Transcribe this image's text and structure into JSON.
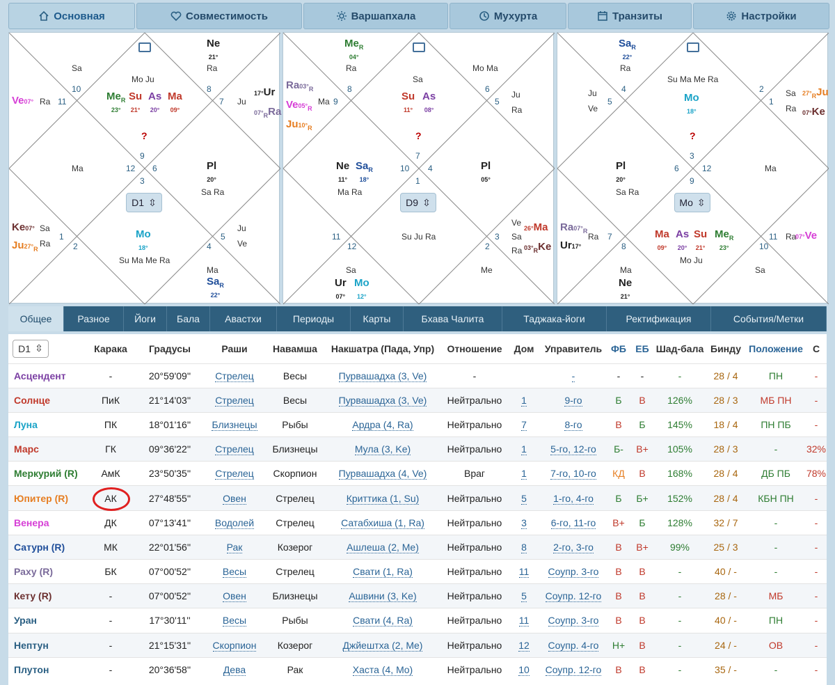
{
  "nav": [
    "Основная",
    "Совместимость",
    "Варшапхала",
    "Мухурта",
    "Транзиты",
    "Настройки"
  ],
  "colors": {
    "Su": "#c0392b",
    "Mo": "#1aa3c7",
    "Ma": "#c0392b",
    "Me": "#2e7d32",
    "Ju": "#e67e22",
    "Ve": "#d63fd6",
    "Sa": "#1f4e9a",
    "Ra": "#7a6a9a",
    "Ke": "#6b2f2f",
    "Ur": "#222",
    "Ne": "#222",
    "Pl": "#222",
    "As": "#7b3fa3"
  },
  "charts": [
    {
      "selector": "D1",
      "question": "?",
      "house_numbers": [
        "1",
        "2",
        "3",
        "4",
        "5",
        "6",
        "7",
        "8",
        "9",
        "10",
        "11",
        "12"
      ],
      "small": [
        "Sa",
        "Mo Ju",
        "Ra",
        "Ra",
        "Ju",
        "Ma",
        "Sa Ra",
        "Sa",
        "Ra",
        "Su Ma Me Ra",
        "Ju",
        "Ve",
        "Ma",
        "Ra"
      ],
      "planets": [
        {
          "p": "Ne",
          "deg": "21°",
          "r": ""
        },
        {
          "p": "Me",
          "deg": "23°",
          "r": "R"
        },
        {
          "p": "Su",
          "deg": "21°",
          "r": ""
        },
        {
          "p": "As",
          "deg": "20°",
          "r": ""
        },
        {
          "p": "Ma",
          "deg": "09°",
          "r": ""
        },
        {
          "p": "Ve",
          "deg": "07°",
          "r": ""
        },
        {
          "p": "Ur",
          "deg": "17°",
          "r": ""
        },
        {
          "p": "Ra",
          "deg": "07°",
          "r": "R"
        },
        {
          "p": "Pl",
          "deg": "20°",
          "r": ""
        },
        {
          "p": "Ke",
          "deg": "07°",
          "r": ""
        },
        {
          "p": "Ju",
          "deg": "27°",
          "r": "R"
        },
        {
          "p": "Mo",
          "deg": "18°",
          "r": ""
        },
        {
          "p": "Sa",
          "deg": "22°",
          "r": "R"
        }
      ]
    },
    {
      "selector": "D9",
      "question": "?",
      "small": [
        "Ra",
        "Sa",
        "Mo Ma",
        "Ma",
        "Ju",
        "Ra",
        "Ma Ra",
        "Sa",
        "Su Ju Ra",
        "Ve",
        "Ra",
        "Me",
        "Sa"
      ],
      "planets": [
        {
          "p": "Me",
          "deg": "04°",
          "r": "R"
        },
        {
          "p": "Ra",
          "deg": "03°",
          "r": "R"
        },
        {
          "p": "Ve",
          "deg": "05°",
          "r": "R"
        },
        {
          "p": "Ju",
          "deg": "10°",
          "r": "R"
        },
        {
          "p": "Su",
          "deg": "11°",
          "r": ""
        },
        {
          "p": "As",
          "deg": "08°",
          "r": ""
        },
        {
          "p": "Ne",
          "deg": "11°",
          "r": ""
        },
        {
          "p": "Sa",
          "deg": "18°",
          "r": "R"
        },
        {
          "p": "Pl",
          "deg": "05°",
          "r": ""
        },
        {
          "p": "Ma",
          "deg": "26°",
          "r": ""
        },
        {
          "p": "Ke",
          "deg": "03°",
          "r": "R"
        },
        {
          "p": "Ur",
          "deg": "07°",
          "r": ""
        },
        {
          "p": "Mo",
          "deg": "12°",
          "r": ""
        }
      ]
    },
    {
      "selector": "Mo",
      "question": "?",
      "small": [
        "Ma",
        "Su Ma Me Ra",
        "Sa",
        "Ra",
        "Ju",
        "Ve",
        "Sa Ra",
        "Ma",
        "Ra",
        "Mo Ju",
        "Ra",
        "Sa",
        "Ra"
      ],
      "planets": [
        {
          "p": "Sa",
          "deg": "22°",
          "r": "R"
        },
        {
          "p": "Mo",
          "deg": "18°",
          "r": ""
        },
        {
          "p": "Ju",
          "deg": "27°",
          "r": "R"
        },
        {
          "p": "Ke",
          "deg": "07°",
          "r": ""
        },
        {
          "p": "Pl",
          "deg": "20°",
          "r": ""
        },
        {
          "p": "Ra",
          "deg": "07°",
          "r": "R"
        },
        {
          "p": "Ur",
          "deg": "17°",
          "r": ""
        },
        {
          "p": "Ma",
          "deg": "09°",
          "r": ""
        },
        {
          "p": "As",
          "deg": "20°",
          "r": ""
        },
        {
          "p": "Su",
          "deg": "21°",
          "r": ""
        },
        {
          "p": "Me",
          "deg": "23°",
          "r": "R"
        },
        {
          "p": "Ve",
          "deg": "07°",
          "r": ""
        },
        {
          "p": "Ne",
          "deg": "21°",
          "r": ""
        }
      ]
    }
  ],
  "tabs": [
    "Общее",
    "Разное",
    "Йоги",
    "Бала",
    "Авастхи",
    "Периоды",
    "Карты",
    "Бхава Чалита",
    "Таджака-йоги",
    "Ректификация",
    "События/Метки"
  ],
  "table": {
    "selector": "D1",
    "headers": [
      "Карака",
      "Градусы",
      "Раши",
      "Навамша",
      "Накшатра (Пада, Упр)",
      "Отношение",
      "Дом",
      "Управитель",
      "ФБ",
      "ЕБ",
      "Шад-бала",
      "Бинду",
      "Положение",
      "С"
    ],
    "rows": [
      {
        "name": "Асцендент",
        "color": "#7b3fa3",
        "karaka": "-",
        "deg": "20°59'09''",
        "rashi": "Стрелец",
        "nav": "Весы",
        "nak": "Пурвашадха (3, Ve)",
        "rel": "-",
        "dom": "",
        "lord": "-",
        "fb": "-",
        "eb": "-",
        "shad": "-",
        "bindu": "28 / 4",
        "pos": "ПН",
        "s": "-"
      },
      {
        "name": "Солнце",
        "color": "#c0392b",
        "karaka": "ПиК",
        "deg": "21°14'03''",
        "rashi": "Стрелец",
        "nav": "Весы",
        "nak": "Пурвашадха (3, Ve)",
        "rel": "Нейтрально",
        "dom": "1",
        "lord": "9-го",
        "fb": "Б",
        "eb": "В",
        "shad": "126%",
        "bindu": "28 / 3",
        "pos": "МБ ПН",
        "s": "-"
      },
      {
        "name": "Луна",
        "color": "#1aa3c7",
        "karaka": "ПК",
        "deg": "18°01'16''",
        "rashi": "Близнецы",
        "nav": "Рыбы",
        "nak": "Ардра (4, Ra)",
        "rel": "Нейтрально",
        "dom": "7",
        "lord": "8-го",
        "fb": "В",
        "eb": "Б",
        "shad": "145%",
        "bindu": "18 / 4",
        "pos": "ПН ПБ",
        "s": "-"
      },
      {
        "name": "Марс",
        "color": "#c0392b",
        "karaka": "ГК",
        "deg": "09°36'22''",
        "rashi": "Стрелец",
        "nav": "Близнецы",
        "nak": "Мула (3, Ke)",
        "rel": "Нейтрально",
        "dom": "1",
        "lord": "5-го, 12-го",
        "fb": "Б-",
        "eb": "В+",
        "shad": "105%",
        "bindu": "28 / 3",
        "pos": "-",
        "s": "32%"
      },
      {
        "name": "Меркурий (R)",
        "color": "#2e7d32",
        "karaka": "АмК",
        "deg": "23°50'35''",
        "rashi": "Стрелец",
        "nav": "Скорпион",
        "nak": "Пурвашадха (4, Ve)",
        "rel": "Враг",
        "dom": "1",
        "lord": "7-го, 10-го",
        "fb": "КД",
        "eb": "В",
        "shad": "168%",
        "bindu": "28 / 4",
        "pos": "ДБ ПБ",
        "s": "78%"
      },
      {
        "name": "Юпитер (R)",
        "color": "#e67e22",
        "karaka": "АК",
        "deg": "27°48'55''",
        "rashi": "Овен",
        "nav": "Стрелец",
        "nak": "Криттика (1, Su)",
        "rel": "Нейтрально",
        "dom": "5",
        "lord": "1-го, 4-го",
        "fb": "Б",
        "eb": "Б+",
        "shad": "152%",
        "bindu": "28 / 4",
        "pos": "КБН ПН",
        "s": "-"
      },
      {
        "name": "Венера",
        "color": "#d63fd6",
        "karaka": "ДК",
        "deg": "07°13'41''",
        "rashi": "Водолей",
        "nav": "Стрелец",
        "nak": "Сатабхиша (1, Ra)",
        "rel": "Нейтрально",
        "dom": "3",
        "lord": "6-го, 11-го",
        "fb": "В+",
        "eb": "Б",
        "shad": "128%",
        "bindu": "32 / 7",
        "pos": "-",
        "s": "-"
      },
      {
        "name": "Сатурн (R)",
        "color": "#1f4e9a",
        "karaka": "МК",
        "deg": "22°01'56''",
        "rashi": "Рак",
        "nav": "Козерог",
        "nak": "Ашлеша (2, Me)",
        "rel": "Нейтрально",
        "dom": "8",
        "lord": "2-го, 3-го",
        "fb": "В",
        "eb": "В+",
        "shad": "99%",
        "bindu": "25 / 3",
        "pos": "-",
        "s": "-"
      },
      {
        "name": "Раху (R)",
        "color": "#7a6a9a",
        "karaka": "БК",
        "deg": "07°00'52''",
        "rashi": "Весы",
        "nav": "Стрелец",
        "nak": "Свати (1, Ra)",
        "rel": "Нейтрально",
        "dom": "11",
        "lord": "Соупр. 3-го",
        "fb": "В",
        "eb": "В",
        "shad": "-",
        "bindu": "40 / -",
        "pos": "-",
        "s": "-"
      },
      {
        "name": "Кету (R)",
        "color": "#6b2f2f",
        "karaka": "-",
        "deg": "07°00'52''",
        "rashi": "Овен",
        "nav": "Близнецы",
        "nak": "Ашвини (3, Ke)",
        "rel": "Нейтрально",
        "dom": "5",
        "lord": "Соупр. 12-го",
        "fb": "В",
        "eb": "В",
        "shad": "-",
        "bindu": "28 / -",
        "pos": "МБ",
        "s": "-"
      },
      {
        "name": "Уран",
        "color": "#2a5f83",
        "karaka": "-",
        "deg": "17°30'11''",
        "rashi": "Весы",
        "nav": "Рыбы",
        "nak": "Свати (4, Ra)",
        "rel": "Нейтрально",
        "dom": "11",
        "lord": "Соупр. 3-го",
        "fb": "В",
        "eb": "В",
        "shad": "-",
        "bindu": "40 / -",
        "pos": "ПН",
        "s": "-"
      },
      {
        "name": "Нептун",
        "color": "#2a5f83",
        "karaka": "-",
        "deg": "21°15'31''",
        "rashi": "Скорпион",
        "nav": "Козерог",
        "nak": "Джйештха (2, Me)",
        "rel": "Нейтрально",
        "dom": "12",
        "lord": "Соупр. 4-го",
        "fb": "Н+",
        "eb": "В",
        "shad": "-",
        "bindu": "24 / -",
        "pos": "ОВ",
        "s": "-"
      },
      {
        "name": "Плутон",
        "color": "#2a5f83",
        "karaka": "-",
        "deg": "20°36'58''",
        "rashi": "Дева",
        "nav": "Рак",
        "nak": "Хаста (4, Mo)",
        "rel": "Нейтрально",
        "dom": "10",
        "lord": "Соупр. 12-го",
        "fb": "В",
        "eb": "В",
        "shad": "-",
        "bindu": "35 / -",
        "pos": "-",
        "s": "-"
      }
    ]
  }
}
